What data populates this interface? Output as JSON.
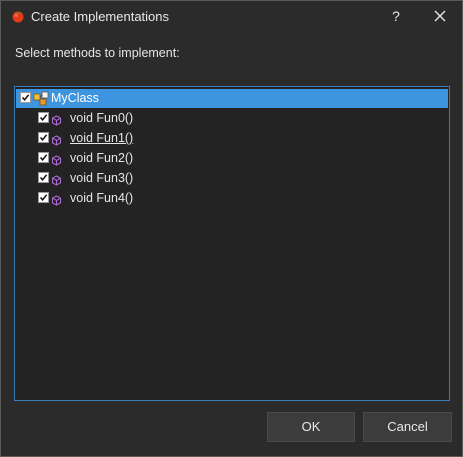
{
  "window": {
    "title": "Create Implementations"
  },
  "titlebar": {
    "help_label": "?",
    "icons": {
      "app": "tomato-icon",
      "close": "close-icon"
    }
  },
  "prompt": "Select methods to implement:",
  "tree": {
    "root": {
      "label": "MyClass",
      "checked": true,
      "selected": true,
      "icon": "class-icon"
    },
    "methods": [
      {
        "label": "void Fun0()",
        "checked": true,
        "underlined": false,
        "icon": "method-icon"
      },
      {
        "label": "void Fun1()",
        "checked": true,
        "underlined": true,
        "icon": "method-icon"
      },
      {
        "label": "void Fun2()",
        "checked": true,
        "underlined": false,
        "icon": "method-icon"
      },
      {
        "label": "void Fun3()",
        "checked": true,
        "underlined": false,
        "icon": "method-icon"
      },
      {
        "label": "void Fun4()",
        "checked": true,
        "underlined": false,
        "icon": "method-icon"
      }
    ]
  },
  "buttons": {
    "ok": "OK",
    "cancel": "Cancel"
  },
  "colors": {
    "background": "#2b2b2b",
    "selection": "#3d95e0",
    "tree_border": "#3d7bbf",
    "method_icon": "#b06cd9"
  }
}
